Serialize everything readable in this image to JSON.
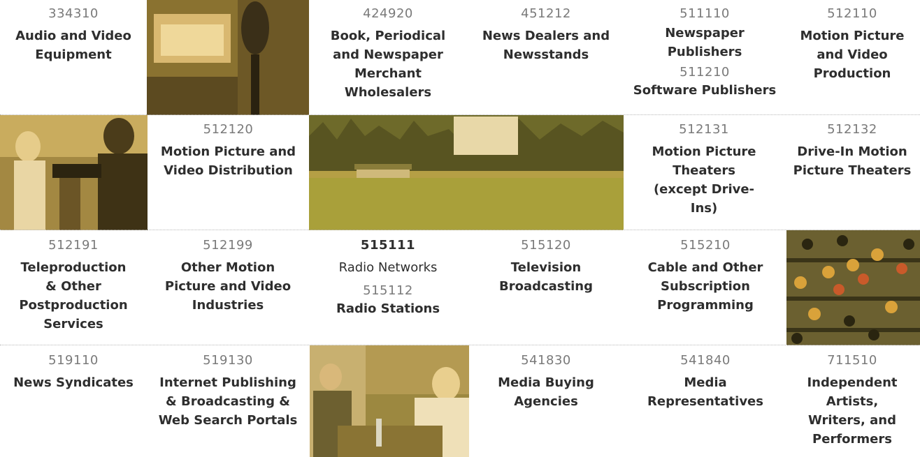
{
  "rows": [
    {
      "cells": [
        {
          "code": "334310",
          "name": "Audio and Video Equipment"
        },
        {
          "image": "studio-microphone-photo"
        },
        {
          "code": "424920",
          "name": "Book, Periodical and Newspaper Merchant Wholesalers"
        },
        {
          "code": "451212",
          "name": "News Dealers and Newsstands"
        },
        {
          "code": "511110",
          "name": "Newspaper Publishers",
          "code2": "511210",
          "name2": "Software Publishers"
        },
        {
          "code": "512110",
          "name": "Motion Picture and Video Production"
        }
      ]
    },
    {
      "cells": [
        {
          "image": "film-crew-camera-photo"
        },
        {
          "code": "512120",
          "name": "Motion Picture and Video Distribution"
        },
        {
          "image": "drive-in-theater-photo"
        },
        {
          "code": "512131",
          "name": "Motion Picture Theaters (except Drive-Ins)"
        },
        {
          "code": "512132",
          "name": "Drive-In Motion Picture Theaters"
        }
      ]
    },
    {
      "cells": [
        {
          "code": "512191",
          "name": "Teleproduction & Other Postproduction Services"
        },
        {
          "code": "512199",
          "name": "Other Motion Picture and Video Industries"
        },
        {
          "code": "515111",
          "name": "Radio Networks",
          "code2": "515112",
          "name2": "Radio Stations"
        },
        {
          "code": "515120",
          "name": "Television Broadcasting"
        },
        {
          "code": "515210",
          "name": "Cable and Other Subscription Programming"
        },
        {
          "image": "mixing-console-photo"
        }
      ]
    },
    {
      "cells": [
        {
          "code": "519110",
          "name": "News Syndicates"
        },
        {
          "code": "519130",
          "name": "Internet Publishing & Broadcasting & Web Search Portals"
        },
        {
          "image": "interview-photo"
        },
        {
          "code": "541830",
          "name": "Media Buying Agencies"
        },
        {
          "code": "541840",
          "name": "Media Representatives"
        },
        {
          "code": "711510",
          "name": "Independent Artists, Writers, and Performers"
        }
      ]
    }
  ],
  "colors": {
    "overlay": "#e8b840",
    "code_text": "#7a7a7a",
    "name_text": "#2e2e2e",
    "separator": "#b8b8b8"
  }
}
